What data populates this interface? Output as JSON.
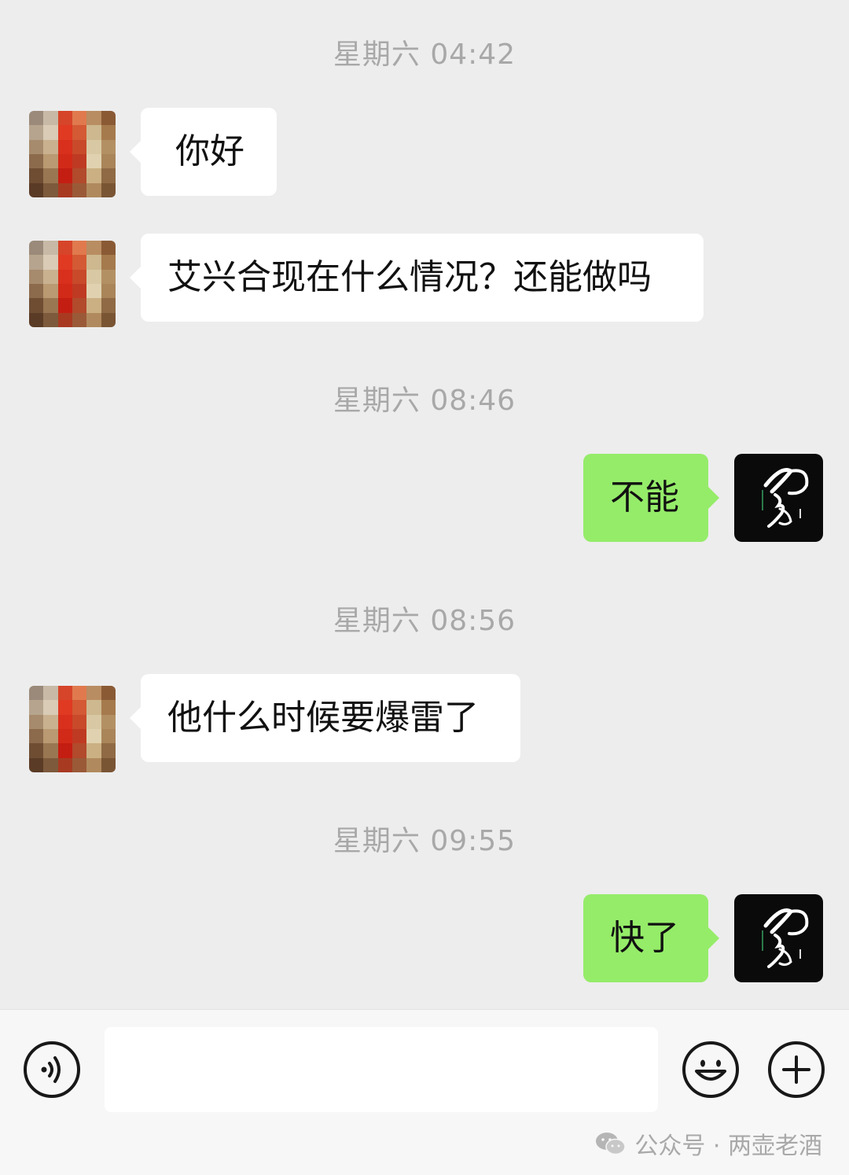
{
  "messages": [
    {
      "type": "timestamp",
      "text": "星期六 04:42"
    },
    {
      "type": "incoming",
      "text": "你好"
    },
    {
      "type": "incoming",
      "text": "艾兴合现在什么情况？还能做吗"
    },
    {
      "type": "timestamp",
      "text": "星期六 08:46"
    },
    {
      "type": "outgoing",
      "text": "不能"
    },
    {
      "type": "timestamp",
      "text": "星期六 08:56"
    },
    {
      "type": "incoming",
      "text": "他什么时候要爆雷了"
    },
    {
      "type": "timestamp",
      "text": "星期六 09:55"
    },
    {
      "type": "outgoing",
      "text": "快了"
    }
  ],
  "input_bar": {
    "voice_icon": "voice-icon",
    "emoji_icon": "emoji-icon",
    "plus_icon": "plus-icon",
    "input_value": ""
  },
  "watermark": {
    "icon": "wechat-icon",
    "text": "公众号 · 两壶老酒"
  },
  "colors": {
    "background": "#ededed",
    "incoming_bubble": "#ffffff",
    "outgoing_bubble": "#95ec69",
    "timestamp_text": "#a8a8a8"
  }
}
